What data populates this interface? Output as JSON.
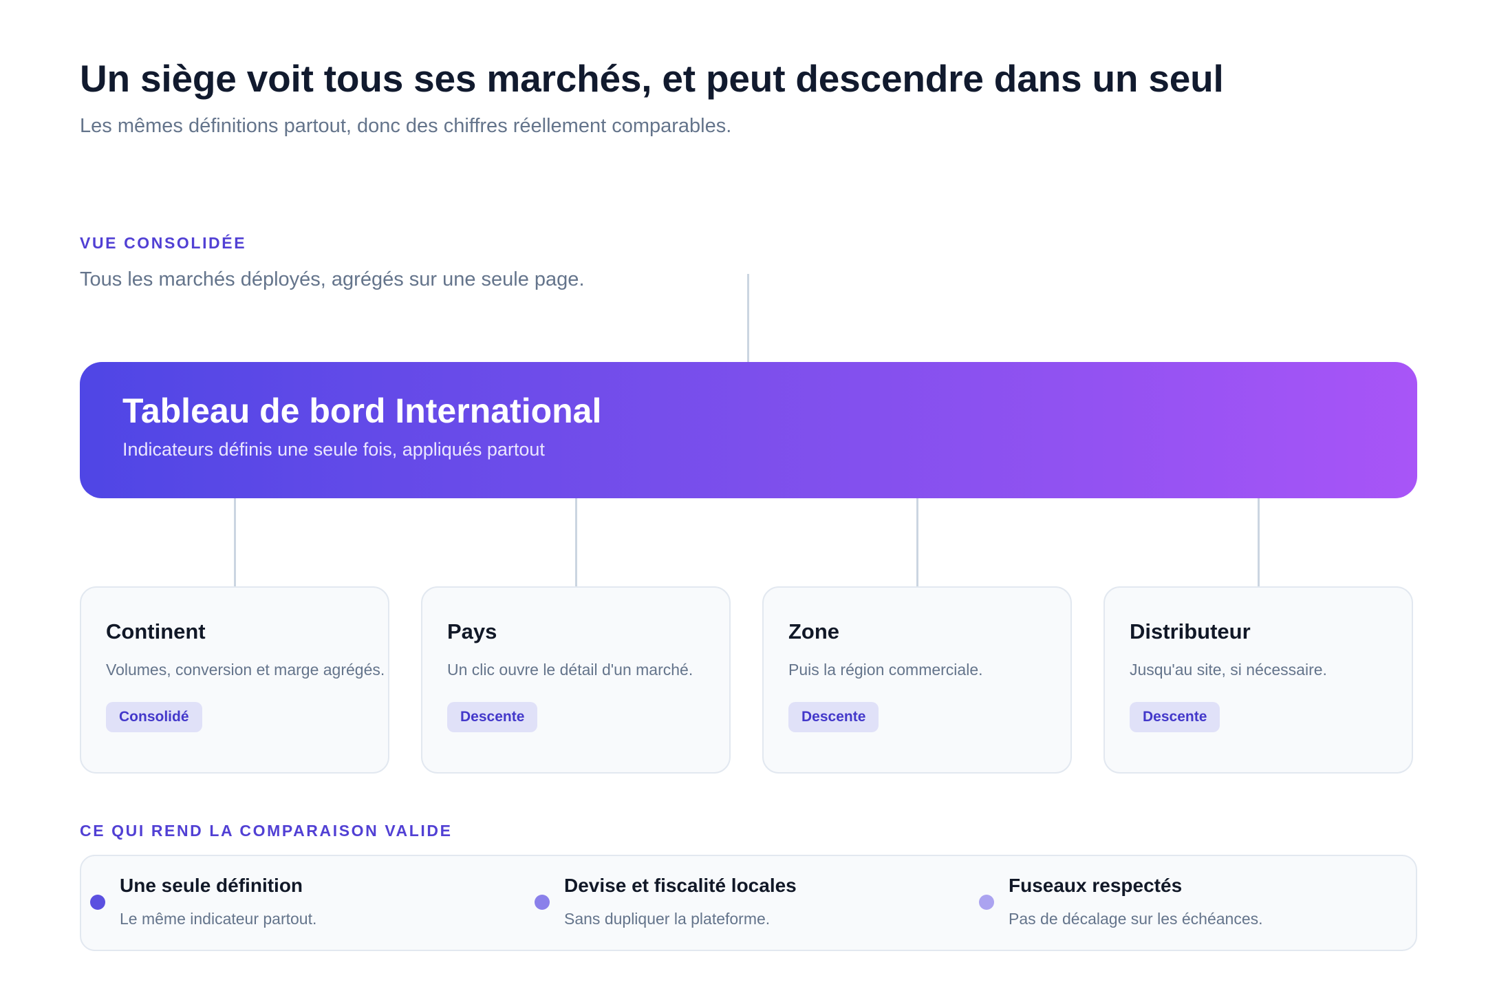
{
  "header": {
    "title": "Un siège voit tous ses marchés, et peut descendre dans un seul",
    "subtitle": "Les mêmes définitions partout, donc des chiffres réellement comparables."
  },
  "consolidated": {
    "label": "VUE CONSOLIDÉE",
    "description": "Tous les marchés déployés, agrégés sur une seule page."
  },
  "dashboard": {
    "title": "Tableau de bord International",
    "subtitle": "Indicateurs définis une seule fois, appliqués partout",
    "gradient_start": "#4f46e5",
    "gradient_end": "#a855f7"
  },
  "levels": [
    {
      "title": "Continent",
      "description": "Volumes, conversion et marge agrégés.",
      "badge": "Consolidé"
    },
    {
      "title": "Pays",
      "description": "Un clic ouvre le détail d'un marché.",
      "badge": "Descente"
    },
    {
      "title": "Zone",
      "description": "Puis la région commerciale.",
      "badge": "Descente"
    },
    {
      "title": "Distributeur",
      "description": "Jusqu'au site, si nécessaire.",
      "badge": "Descente"
    }
  ],
  "criteria": {
    "label": "CE QUI REND LA COMPARAISON VALIDE",
    "items": [
      {
        "title": "Une seule définition",
        "description": "Le même indicateur partout.",
        "dot_color": "#5b50e0"
      },
      {
        "title": "Devise et fiscalité locales",
        "description": "Sans dupliquer la plateforme.",
        "dot_color": "#8a80ea"
      },
      {
        "title": "Fuseaux respectés",
        "description": "Pas de décalage sur les échéances.",
        "dot_color": "#aba3f0"
      }
    ]
  },
  "colors": {
    "accent": "#5140d4",
    "connector": "#cbd5e1",
    "badge_bg": "#e0e1f8",
    "badge_text": "#4338ca"
  }
}
